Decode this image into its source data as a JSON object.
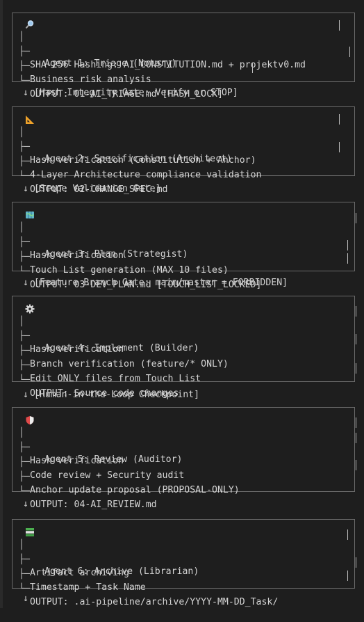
{
  "agents": [
    {
      "icon": "magnifier-icon",
      "title": "Agent 1: Triage (Notary)",
      "lines": [
        "SHA-256 Hashing: AI_CONSTITUTION.md + projektv0.md",
        "Business risk analysis",
        "OUTPUT: 01-AI_TRIAGE.md [HASH_LOCK]"
      ]
    },
    {
      "icon": "triangle-ruler-icon",
      "title": "Agent 2: Specification (Architect)",
      "lines": [
        "Hash verification (Constitution + Anchor)",
        "4-Layer Architecture compliance validation",
        "OUTPUT: 02-CHANGE_SPEC.md"
      ]
    },
    {
      "icon": "map-icon",
      "title": "Agent 3: Plan (Strategist)",
      "lines": [
        "Hash verification",
        "Touch List generation (MAX 10 files)",
        "OUTPUT: 03-DEV_PLAN.md [TOUCH_LIST_LOCKED]"
      ]
    },
    {
      "icon": "gear-icon",
      "title": "Agent 4: Implement (Builder)",
      "lines": [
        "Hash verification",
        "Branch verification (feature/* ONLY)",
        "Edit ONLY files from Touch List",
        "OUTPUT: Source code changes"
      ]
    },
    {
      "icon": "shield-icon",
      "title": "Agent 5: Review (Auditor)",
      "lines": [
        "Hash verification",
        "Code review + Security audit",
        "Anchor update proposal (PROPOSAL-ONLY)",
        "OUTPUT: 04-AI_REVIEW.md"
      ]
    },
    {
      "icon": "books-icon",
      "title": "Agent 6: Archive (Librarian)",
      "lines": [
        "Artifact archiving",
        "Timestamp + Task Name",
        "OUTPUT: .ai-pipeline/archive/YYYY-MM-DD_Task/"
      ]
    }
  ],
  "gates": [
    "↓ [Hash Integrity Gate: Verify or STOP]",
    "↓ [Scope Validation Gate]",
    "↓ [Feature Branch Gate: main/master = FORBIDDEN]",
    "↓ [Human-in-the-Loop Checkpoint]",
    "↓",
    "↓"
  ],
  "glyphs": {
    "branch": "├─",
    "last": "└─",
    "pipe": "│"
  }
}
